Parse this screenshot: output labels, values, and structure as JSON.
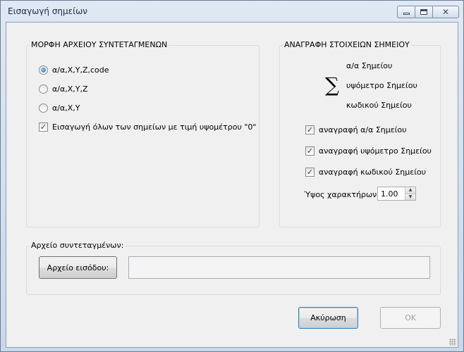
{
  "window": {
    "title": "Εισαγωγή σημείων",
    "close_glyph": "✕"
  },
  "format_group": {
    "title": "ΜΟΡΦΗ ΑΡΧΕΙΟΥ ΣΥΝΤΕΤΑΓΜΕΝΩΝ",
    "options": [
      {
        "label": "α/α,X,Y,Z,code",
        "selected": true
      },
      {
        "label": "α/α,X,Y,Z",
        "selected": false
      },
      {
        "label": "α/α,X,Y",
        "selected": false
      }
    ],
    "zero_elevation_label": "Εισαγωγή όλων των σημείων με τιμή υψομέτρου \"0\"",
    "zero_elevation_checked": true
  },
  "annotation_group": {
    "title": "ΑΝΑΓΡΑΦΗ ΣΤΟΙΧΕΙΩΝ ΣΗΜΕΙΟΥ",
    "sigma_symbol": "∑",
    "preview_lines": [
      "α/α Σημείου",
      "υψόμετρο Σημείου",
      "κωδικού Σημείου"
    ],
    "checks": [
      {
        "label": "αναγραφή α/α Σημείου",
        "checked": true
      },
      {
        "label": "αναγραφή υψόμετρο Σημείου",
        "checked": true
      },
      {
        "label": "αναγραφή κωδικού Σημείου",
        "checked": true
      }
    ],
    "char_height_label": "Ύψος χαρακτήρων:",
    "char_height_value": "1.00"
  },
  "file_group": {
    "title": "Αρχείο συντεταγμένων:",
    "input_button_label": "Αρχείο εισόδου:",
    "file_path": ""
  },
  "footer": {
    "cancel_label": "Ακύρωση",
    "ok_label": "OK",
    "ok_enabled": false
  },
  "colors": {
    "accent": "#3c7fb1",
    "check_mark": "#1c3e70"
  }
}
